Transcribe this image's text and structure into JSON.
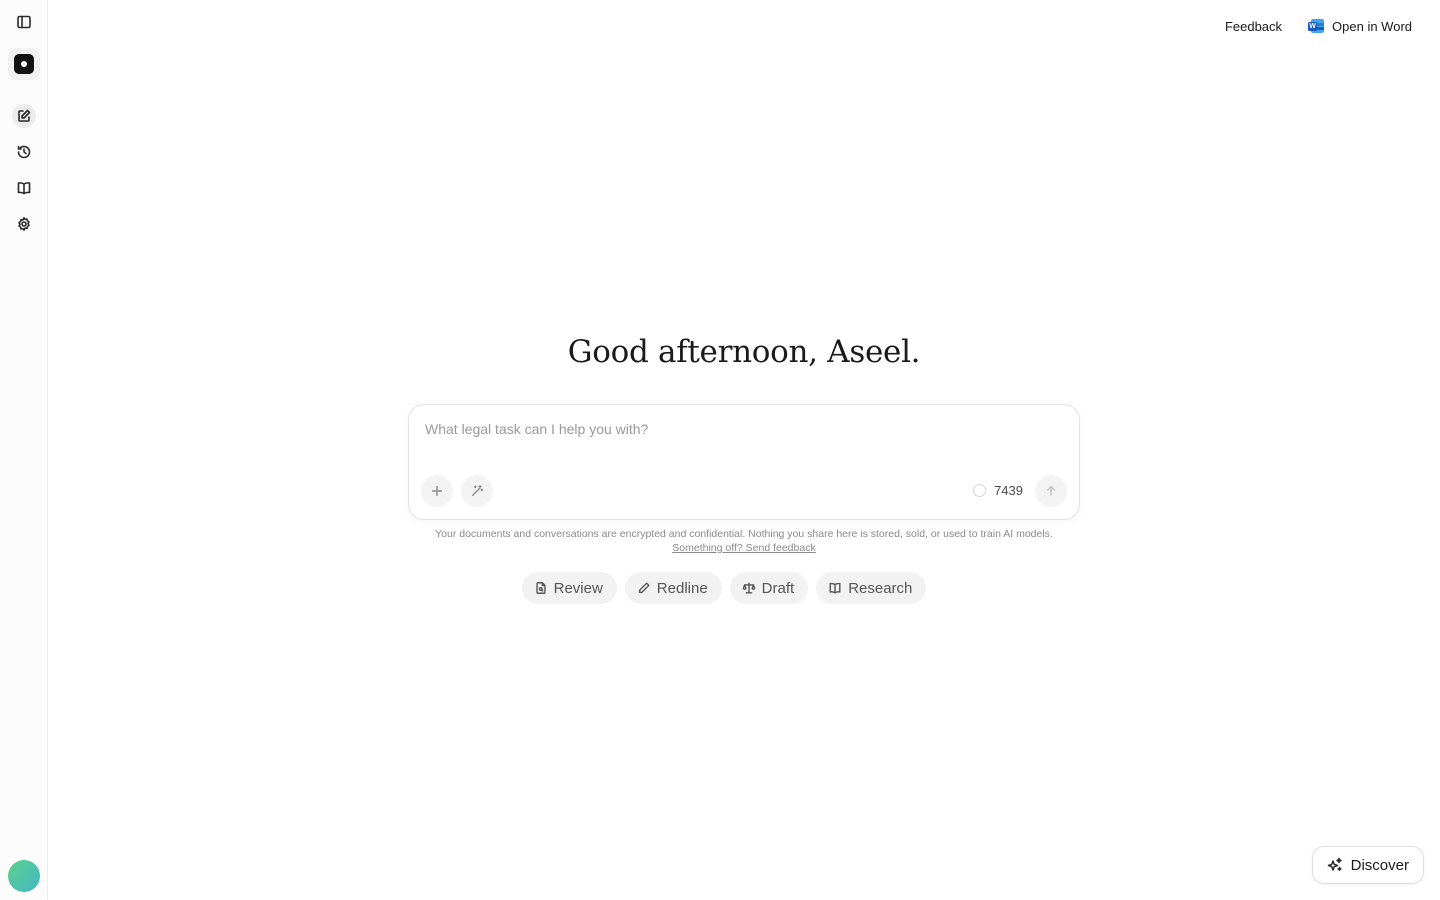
{
  "sidebar": {
    "toggle_icon": "sidebar-toggle-icon",
    "logo_icon": "app-logo",
    "items": [
      {
        "icon": "new-chat-icon"
      },
      {
        "icon": "history-icon"
      },
      {
        "icon": "library-icon"
      },
      {
        "icon": "settings-icon"
      }
    ],
    "avatar_colors": [
      "#5fd08a",
      "#43b6c4"
    ]
  },
  "topbar": {
    "feedback_label": "Feedback",
    "open_in_word_label": "Open in Word",
    "word_icon_letter": "W"
  },
  "main": {
    "greeting": "Good afternoon, Aseel.",
    "prompt_placeholder": "What legal task can I help you with?",
    "credits": "7439",
    "disclaimer": "Your documents and conversations are encrypted and confidential. Nothing you share here is stored, sold, or used to train AI models.",
    "feedback_link": "Something off? Send feedback",
    "chips": [
      {
        "label": "Review",
        "icon": "document-search-icon"
      },
      {
        "label": "Redline",
        "icon": "pen-icon"
      },
      {
        "label": "Draft",
        "icon": "scale-icon"
      },
      {
        "label": "Research",
        "icon": "book-open-icon"
      }
    ]
  },
  "discover": {
    "label": "Discover",
    "icon": "sparkles-icon"
  }
}
